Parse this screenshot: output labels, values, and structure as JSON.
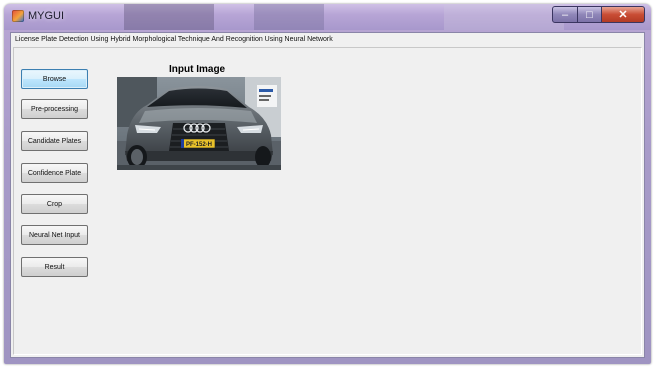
{
  "window": {
    "title": "MYGUI",
    "controls": {
      "minimize": "–",
      "maximize": "□",
      "close": "✕"
    }
  },
  "header": {
    "text": "License Plate Detection Using Hybrid Morphological Technique And Recognition Using Neural Network"
  },
  "buttons": [
    {
      "label": "Browse",
      "active": true
    },
    {
      "label": "Pre-processing",
      "active": false
    },
    {
      "label": "Candidate Plates",
      "active": false
    },
    {
      "label": "Confidence Plate",
      "active": false
    },
    {
      "label": "Crop",
      "active": false
    },
    {
      "label": "Neural Net Input",
      "active": false
    },
    {
      "label": "Result",
      "active": false
    }
  ],
  "input_panel": {
    "title": "Input Image",
    "plate_text": "PF-152-H"
  },
  "colors": {
    "titlebar": "#b7a5d6",
    "client_bg": "#f0f0f0",
    "active_button": "#bee6fd",
    "close_button": "#c94d35",
    "plate_yellow": "#e9c22a"
  }
}
